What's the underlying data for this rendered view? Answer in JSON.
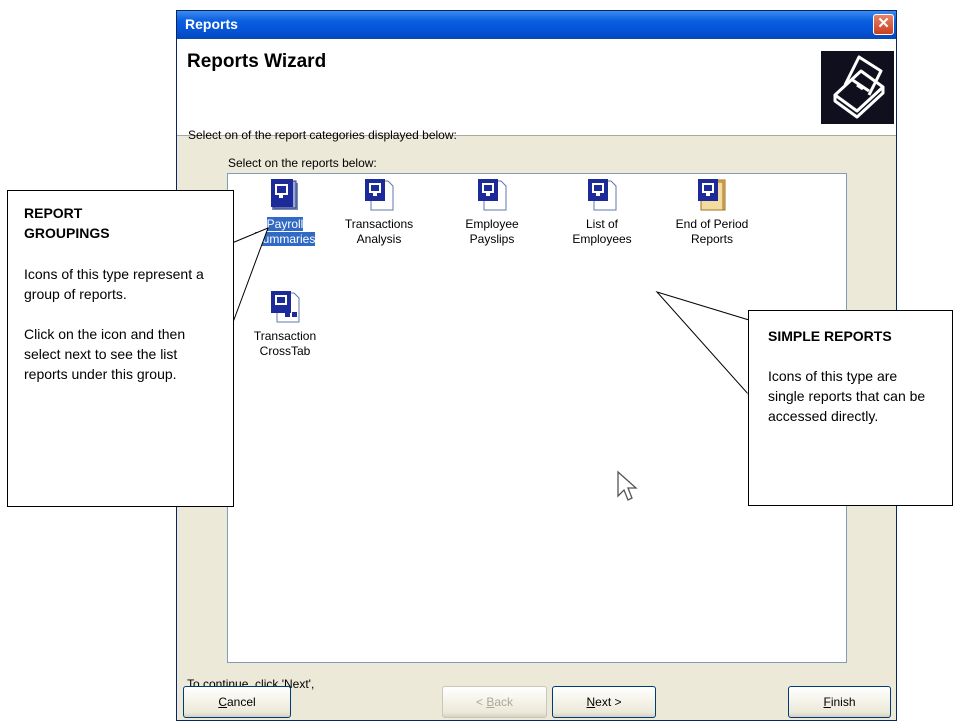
{
  "window": {
    "title": "Reports",
    "close_glyph": "✕"
  },
  "header": {
    "title": "Reports Wizard",
    "subtitle": "Select on of the report categories displayed below:",
    "icon": "printer-icon"
  },
  "list": {
    "label": "Select on the reports below:",
    "items": [
      {
        "label": "Payroll Summaries",
        "line1": "Payroll",
        "line2": "Summaries",
        "icon": "report-group-icon",
        "selected": true
      },
      {
        "label": "Transactions Analysis",
        "line1": "Transactions",
        "line2": "Analysis",
        "icon": "report-icon"
      },
      {
        "label": "Employee Payslips",
        "line1": "Employee",
        "line2": "Payslips",
        "icon": "report-icon"
      },
      {
        "label": "List of Employees",
        "line1": "List of",
        "line2": "Employees",
        "icon": "report-icon"
      },
      {
        "label": "End of Period Reports",
        "line1": "End of Period",
        "line2": "Reports",
        "icon": "report-group-icon"
      },
      {
        "label": "Transaction CrossTab",
        "line1": "Transaction",
        "line2": "CrossTab",
        "icon": "crosstab-report-icon"
      }
    ]
  },
  "status_text": "To continue, click 'Next',",
  "buttons": {
    "cancel_pre": "",
    "cancel_u": "C",
    "cancel_post": "ancel",
    "back_pre": "< ",
    "back_u": "B",
    "back_post": "ack",
    "next_pre": "",
    "next_u": "N",
    "next_post": "ext >",
    "finish_pre": "",
    "finish_u": "F",
    "finish_post": "inish"
  },
  "callouts": {
    "groupings": {
      "heading_line1": "REPORT",
      "heading_line2": "GROUPINGS",
      "p1": "Icons of this type represent a group of reports.",
      "p2": "Click on the icon and then select next to see the list reports under this group."
    },
    "simple": {
      "heading": "SIMPLE REPORTS",
      "p1": "Icons of this type are single reports that can be accessed directly."
    }
  },
  "colors": {
    "titlebar": "#0553d6",
    "selection": "#316ac5",
    "dialog_bg": "#ece9d8"
  }
}
